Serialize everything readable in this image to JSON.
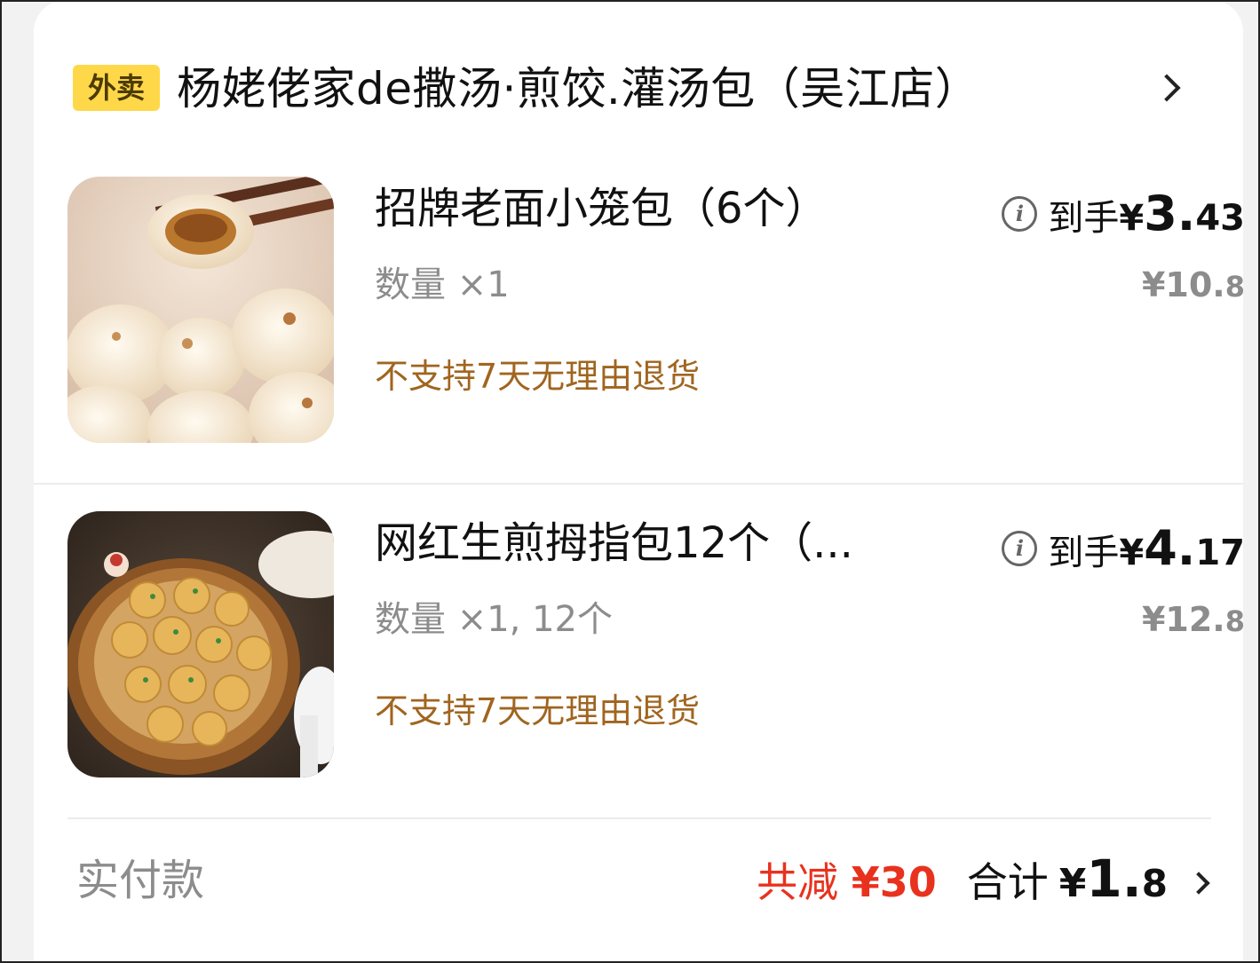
{
  "order": {
    "tag": "外卖",
    "shop_name": "杨姥佬家de撒汤·煎饺.灌汤包（吴江店）",
    "items": [
      {
        "title": "招牌老面小笼包（6个）",
        "qty": "数量 ×1",
        "policy": "不支持7天无理由退货",
        "arrive_label": "到手",
        "currency": "¥",
        "price_int": "3.",
        "price_dec": "43",
        "original_int": "¥10.",
        "original_dec": "8",
        "image_icon": "steamed-bun-photo"
      },
      {
        "title": "网红生煎拇指包12个（...",
        "qty": "数量 ×1, 12个",
        "policy": "不支持7天无理由退货",
        "arrive_label": "到手",
        "currency": "¥",
        "price_int": "4.",
        "price_dec": "17",
        "original_int": "¥12.",
        "original_dec": "8",
        "image_icon": "pan-fried-bun-photo"
      }
    ],
    "footer": {
      "pay_label": "实付款",
      "discount_label": "共减",
      "discount_amount": "¥30",
      "total_label": "合计",
      "total_currency": "¥",
      "total_int": "1.",
      "total_dec": "8"
    }
  },
  "colors": {
    "badge_bg": "#ffd84a",
    "policy_text": "#a0651f",
    "discount_text": "#e8321e",
    "muted_text": "#8c8c8c"
  }
}
